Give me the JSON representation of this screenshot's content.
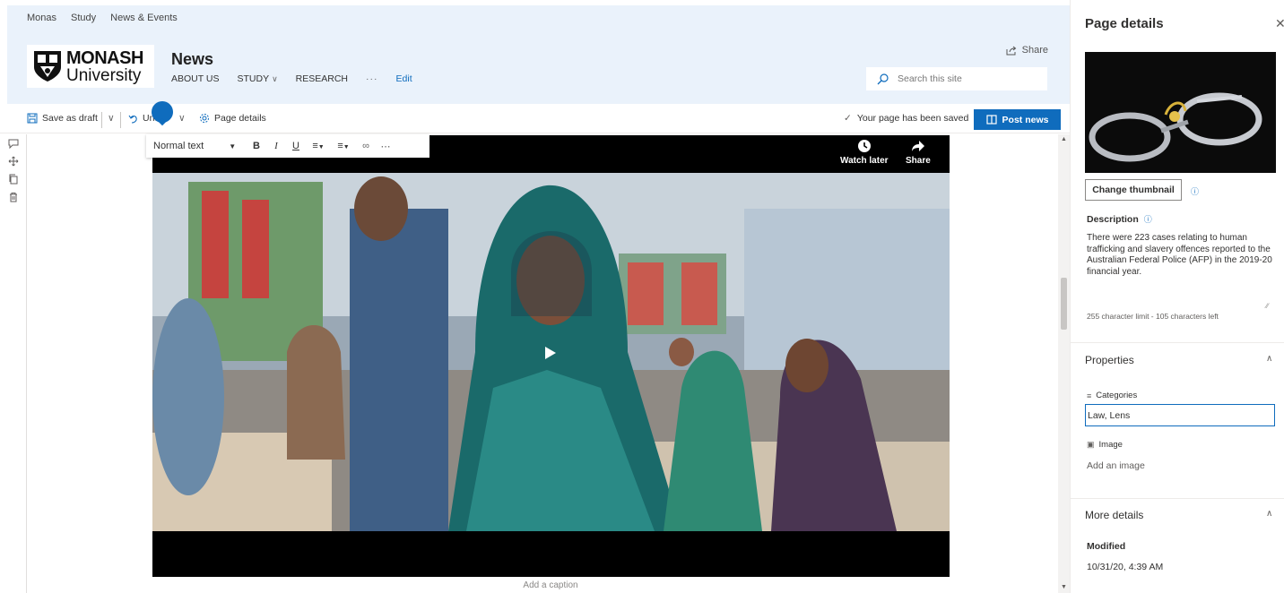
{
  "suitebar": {
    "items": [
      "Monas",
      "Study",
      "News & Events"
    ]
  },
  "header": {
    "logo_line1": "MONASH",
    "logo_line2": "University",
    "site_title": "News",
    "nav": [
      {
        "label": "ABOUT US"
      },
      {
        "label": "STUDY"
      },
      {
        "label": "RESEARCH"
      },
      {
        "label": "···"
      },
      {
        "label": "Edit"
      }
    ],
    "share_label": "Share",
    "search_placeholder": "Search this site"
  },
  "toolbar": {
    "save_draft": "Save as draft",
    "undo": "Undo",
    "page_details": "Page details",
    "saved_status": "Your page has been saved",
    "post_news": "Post news"
  },
  "editor": {
    "text_style": "Normal text",
    "caption_placeholder": "Add a caption"
  },
  "video": {
    "watch_later": "Watch later",
    "share": "Share"
  },
  "panel": {
    "title": "Page details",
    "change_thumbnail": "Change thumbnail",
    "description_label": "Description",
    "description_text": "There were 223 cases relating to human trafficking and slavery offences reported to the Australian Federal Police (AFP) in the 2019-20 financial year.",
    "char_limit": "255 character limit - 105 characters left",
    "properties_label": "Properties",
    "categories_label": "Categories",
    "categories_value": "Law, Lens",
    "image_label": "Image",
    "add_image": "Add an image",
    "more_details_label": "More details",
    "modified_label": "Modified",
    "modified_value": "10/31/20, 4:39 AM"
  },
  "colors": {
    "accent": "#0f6cbd",
    "header_bg": "#eaf2fb"
  }
}
